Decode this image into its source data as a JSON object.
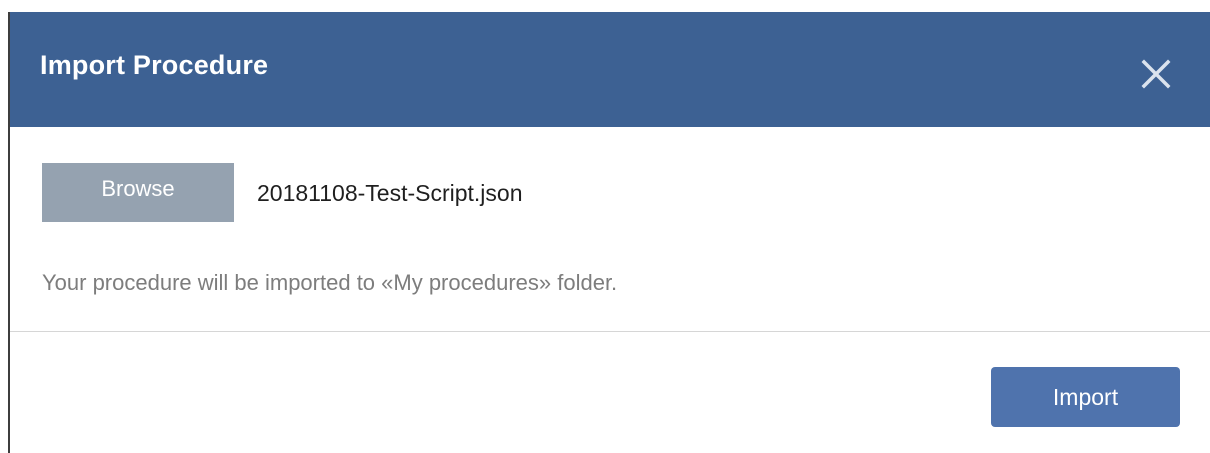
{
  "dialog": {
    "title": "Import Procedure",
    "close_icon": "close-icon"
  },
  "file_picker": {
    "browse_label": "Browse",
    "file_name": "20181108-Test-Script.json"
  },
  "info_text": "Your procedure will be imported to «My procedures» folder.",
  "footer": {
    "import_label": "Import"
  },
  "colors": {
    "header_bg": "#3d6193",
    "browse_bg": "#95a2b0",
    "import_bg": "#4f73ad",
    "info_text": "#7d7d7d"
  }
}
